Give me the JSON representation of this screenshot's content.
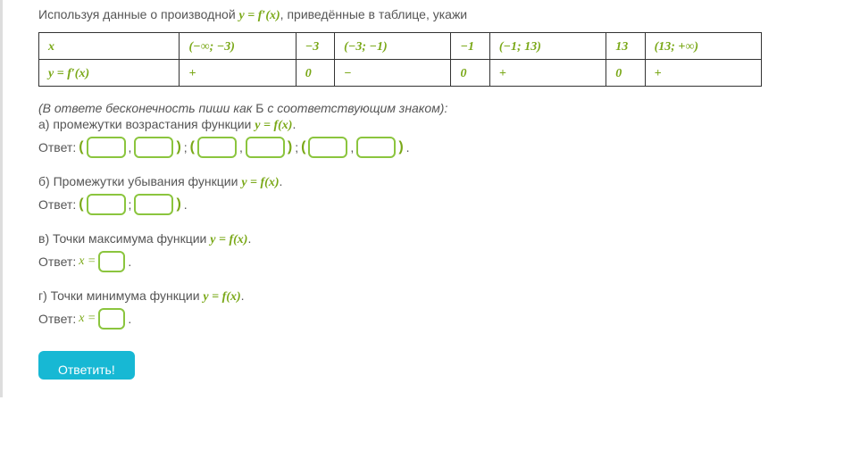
{
  "prompt_prefix": "Используя данные о производной ",
  "prompt_math": "y = f′(x)",
  "prompt_suffix": ", приведённые в таблице, укажи",
  "table": {
    "row1": [
      "x",
      "(−∞; −3)",
      "−3",
      "(−3; −1)",
      "−1",
      "(−1; 13)",
      "13",
      "(13; +∞)"
    ],
    "row2": [
      "y = f′(x)",
      "+",
      "0",
      "−",
      "0",
      "+",
      "0",
      "+"
    ]
  },
  "hint_prefix": "(В ответе бесконечность пиши как ",
  "hint_b": "Б",
  "hint_suffix": " с соответствующим знаком):",
  "q_a_prefix": "а) промежутки возрастания функции ",
  "q_math_fx": "y = f(x)",
  "q_b_prefix": "б) Промежутки убывания функции ",
  "q_c_prefix": "в) Точки максимума функции ",
  "q_d_prefix": "г) Точки минимума функции ",
  "answer_label": "Ответ:",
  "x_eq": "x =",
  "period": ".",
  "comma": ",",
  "semicolon": ";",
  "semi2": ";",
  "open_paren": "(",
  "close_paren": ")",
  "submit": "Ответить!"
}
